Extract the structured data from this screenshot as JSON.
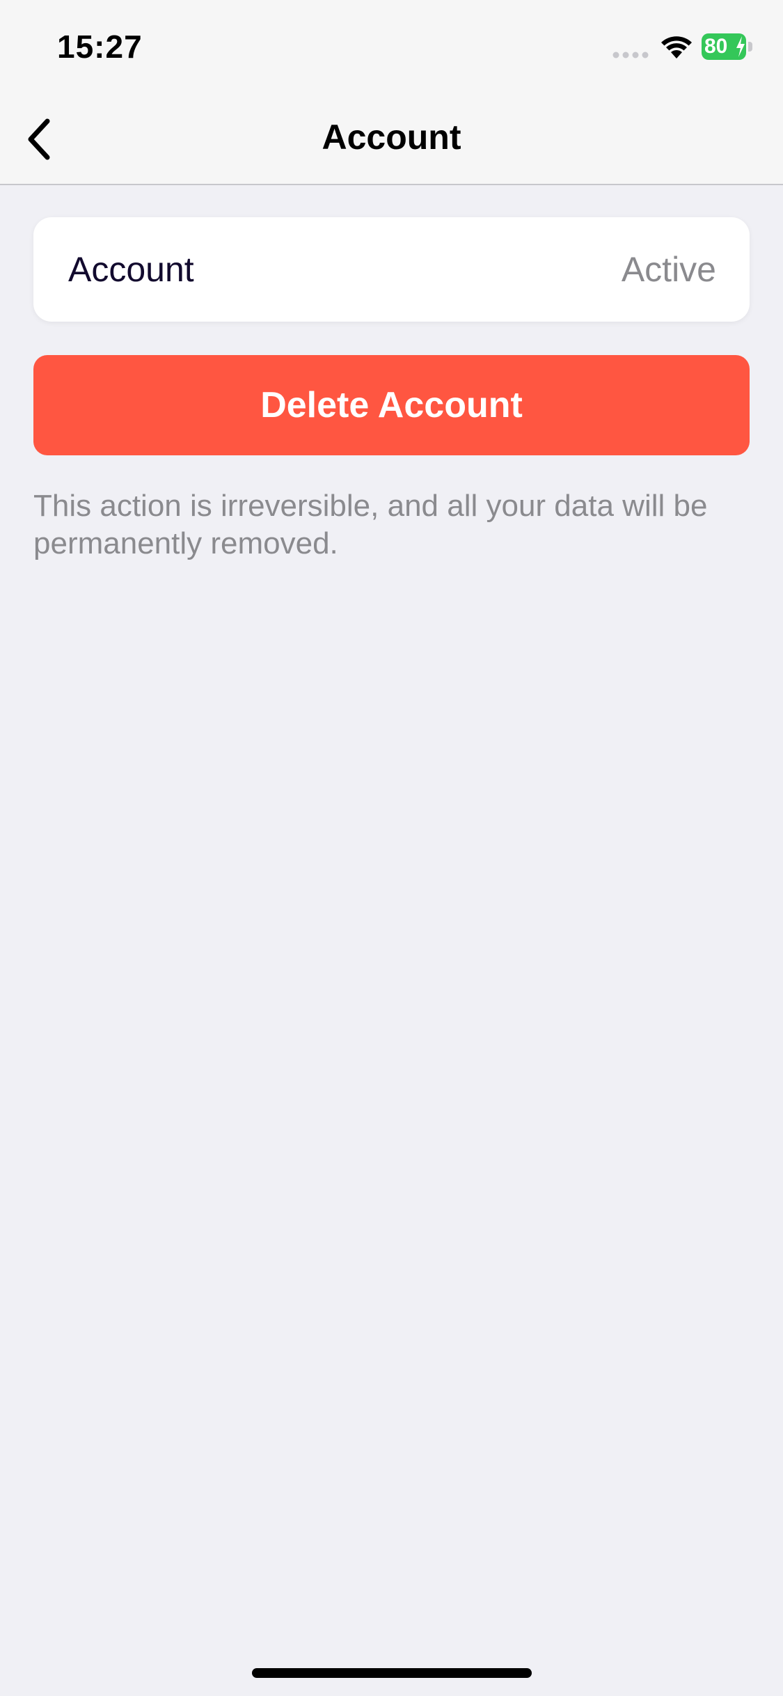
{
  "status_bar": {
    "time": "15:27",
    "battery_level": "80",
    "battery_charging": true,
    "battery_color": "#34c759"
  },
  "nav": {
    "title": "Account",
    "back_icon": "chevron-left-icon"
  },
  "account_row": {
    "label": "Account",
    "status": "Active"
  },
  "delete_button": {
    "label": "Delete Account",
    "color": "#ff5641"
  },
  "warning": {
    "text": "This action is irreversible, and all your data will be permanently removed."
  }
}
